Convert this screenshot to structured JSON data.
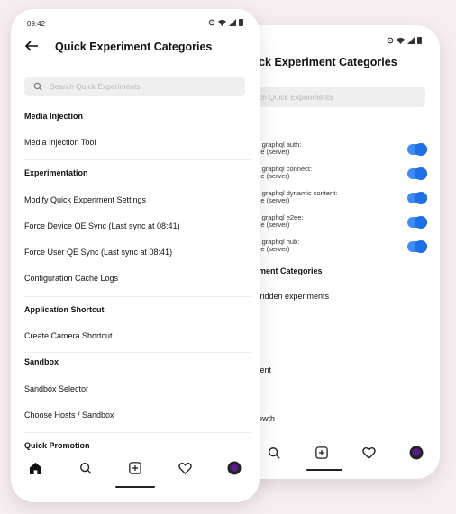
{
  "front": {
    "status_time": "09:42",
    "title": "Quick Experiment Categories",
    "search_placeholder": "Search Quick Experiments",
    "sections": [
      {
        "title": "Media Injection",
        "items": [
          "Media Injection Tool"
        ]
      },
      {
        "title": "Experimentation",
        "items": [
          "Modify Quick Experiment Settings",
          "Force Device QE Sync (Last sync at 08:41)",
          "Force User QE Sync (Last sync at 08:41)",
          "Configuration Cache Logs"
        ]
      },
      {
        "title": "Application Shortcut",
        "items": [
          "Create Camera Shortcut"
        ]
      },
      {
        "title": "Sandbox",
        "items": [
          "Sandbox Selector",
          "Choose Hosts / Sandbox"
        ]
      },
      {
        "title": "Quick Promotion",
        "items": []
      }
    ]
  },
  "back": {
    "title": "uick Experiment Categories",
    "search_placeholder": "rch Quick Experiments",
    "section1": "ms",
    "settings": [
      {
        "l1": "ring graphql auth:",
        "l2": "· true (server)"
      },
      {
        "l1": "ring graphql connect:",
        "l2": "· true (server)"
      },
      {
        "l1": "ring graphql dynamic content:",
        "l2": "· true (server)"
      },
      {
        "l1": "ring graphql e2ee:",
        "l2": "· true (server)"
      },
      {
        "l1": "ring graphql hub:",
        "l2": "· true (server)"
      }
    ],
    "section2": "eriment Categories",
    "items": [
      "verridden experiments",
      "ontent",
      "Growth"
    ]
  },
  "colors": {
    "toggle": "#3d8cf7",
    "avatar": "#5a1a8a"
  }
}
